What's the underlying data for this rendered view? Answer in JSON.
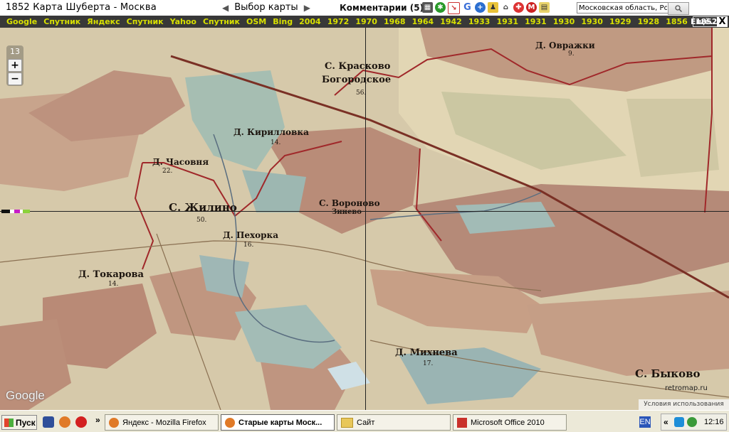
{
  "header": {
    "title": "1852 Карта Шуберта - Москва",
    "map_select_label": "Выбор карты",
    "comments_label": "Комментарии (5)",
    "search_value": "Московская область, Росси",
    "prev_arrow": "◀",
    "next_arrow": "▶"
  },
  "layers": {
    "items": [
      "Google",
      "Спутник",
      "Яндекс",
      "Спутник",
      "Yahoo",
      "Спутник",
      "OSM",
      "Bing",
      "2004",
      "1972",
      "1970",
      "1968",
      "1964",
      "1942",
      "1933",
      "1931",
      "1931",
      "1930",
      "1930",
      "1929",
      "1928",
      "1856",
      "1852"
    ],
    "active": "1852",
    "more_label": "Ещё...",
    "close_label": "X"
  },
  "map": {
    "zoom_level": "13",
    "zoom_in": "+",
    "zoom_out": "−",
    "places": [
      {
        "name": "Д. Овражки",
        "num": "9."
      },
      {
        "name": "С. Красково",
        "num": ""
      },
      {
        "name": "Богородское",
        "num": "56."
      },
      {
        "name": "Д. Кирилловка",
        "num": "14."
      },
      {
        "name": "Д. Часовня",
        "num": "22."
      },
      {
        "name": "С. Жилино",
        "num": "50."
      },
      {
        "name": "С. Вороново",
        "num": ""
      },
      {
        "name": "Зинево",
        "num": ""
      },
      {
        "name": "Д. Пехорка",
        "num": "16."
      },
      {
        "name": "Д. Токарова",
        "num": "14."
      },
      {
        "name": "Д. Михнева",
        "num": "17."
      },
      {
        "name": "С. Быково",
        "num": ""
      }
    ],
    "google_logo": "Google",
    "watermark": "retromap.ru",
    "terms_label": "Условия использования"
  },
  "taskbar": {
    "start_label": "Пуск",
    "windows": [
      {
        "label": "Яндекс - Mozilla Firefox",
        "active": false
      },
      {
        "label": "Старые карты Моск...",
        "active": true
      },
      {
        "label": "Сайт",
        "active": false
      },
      {
        "label": "Microsoft Office 2010",
        "active": false
      }
    ],
    "overflow": "»",
    "tray_expand": "«",
    "lang": "EN",
    "clock": "12:16"
  },
  "colors": {
    "layer_text": "#d8e000",
    "layer_bar": "#383838",
    "map_paper": "#d8ccb0",
    "field_pink": "#b58a78",
    "water_blue": "#9cb8b4",
    "boundary_red": "#a0282a"
  }
}
